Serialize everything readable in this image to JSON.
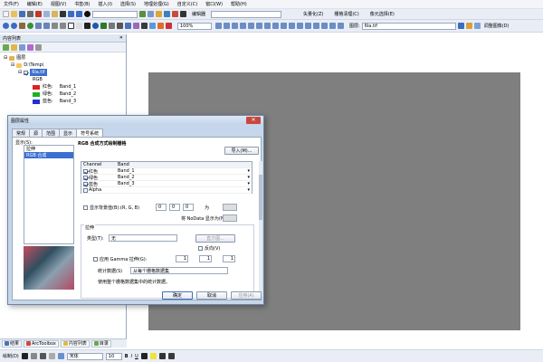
{
  "menu": [
    "文件(F)",
    "编辑(E)",
    "视图(V)",
    "书签(B)",
    "插入(I)",
    "选择(S)",
    "地理处理(G)",
    "自定义(C)",
    "窗口(W)",
    "帮助(H)"
  ],
  "toolbar1": {
    "scale_value": "",
    "editor_label": "编辑器",
    "vectorize_label": "矢量化(Z)",
    "cleanup_label": "栅格清理(C)",
    "cell_select_label": "像元选择(E)"
  },
  "toolbar2": {
    "zoom_value": "100%",
    "layer_label": "图层:",
    "layer_value": "6la.tif",
    "adjust_label": "调整图像(D)"
  },
  "toc": {
    "title": "内容列表",
    "root": "图层",
    "folder": "D:\\Temp\\",
    "layer": "6la.tif",
    "rgb": "RGB",
    "bands": [
      {
        "label": "红色:",
        "band": "Band_1",
        "color": "#e02020"
      },
      {
        "label": "绿色:",
        "band": "Band_2",
        "color": "#20b020"
      },
      {
        "label": "蓝色:",
        "band": "Band_3",
        "color": "#2030d0"
      }
    ]
  },
  "bottom_tabs": [
    "结果",
    "ArcToolbox",
    "内容列表",
    "目录"
  ],
  "drawbar": {
    "label": "绘制(D)",
    "font": "宋体",
    "size": "10"
  },
  "dialog": {
    "title": "图层属性",
    "tabs": [
      "常规",
      "源",
      "范围",
      "显示",
      "符号系统"
    ],
    "show_label": "显示(S):",
    "show_items": [
      "拉伸",
      "RGB 合成"
    ],
    "heading": "RGB 合成方式绘制栅格",
    "import_button": "导入(M)...",
    "table_headers": [
      "Channel",
      "Band"
    ],
    "channels": [
      {
        "name": "红色",
        "band": "Band_1",
        "checked": true
      },
      {
        "name": "绿色",
        "band": "Band_2",
        "checked": true
      },
      {
        "name": "蓝色",
        "band": "Band_3",
        "checked": true
      },
      {
        "name": "Alpha",
        "band": "",
        "checked": false
      }
    ],
    "bg_label": "显示背景值(B):(R, G, B)",
    "bg_values": [
      "0",
      "0",
      "0"
    ],
    "as_label": "为",
    "nodata_label": "将 NoData 显示为(N)",
    "stretch_group": "拉伸",
    "type_label": "类型(T):",
    "type_value": "无",
    "histogram_button": "直方图...",
    "invert_label": "反向(V)",
    "gamma_label": "应用 Gamma 拉伸(G):",
    "gamma_values": [
      "1",
      "1",
      "1"
    ],
    "stats_label": "统计数据(S)",
    "stats_value": "从每个栅格数据集",
    "stats_note": "使用整个栅格数据集中的统计数据。",
    "ok": "确定",
    "cancel": "取消",
    "apply": "应用(A)"
  }
}
